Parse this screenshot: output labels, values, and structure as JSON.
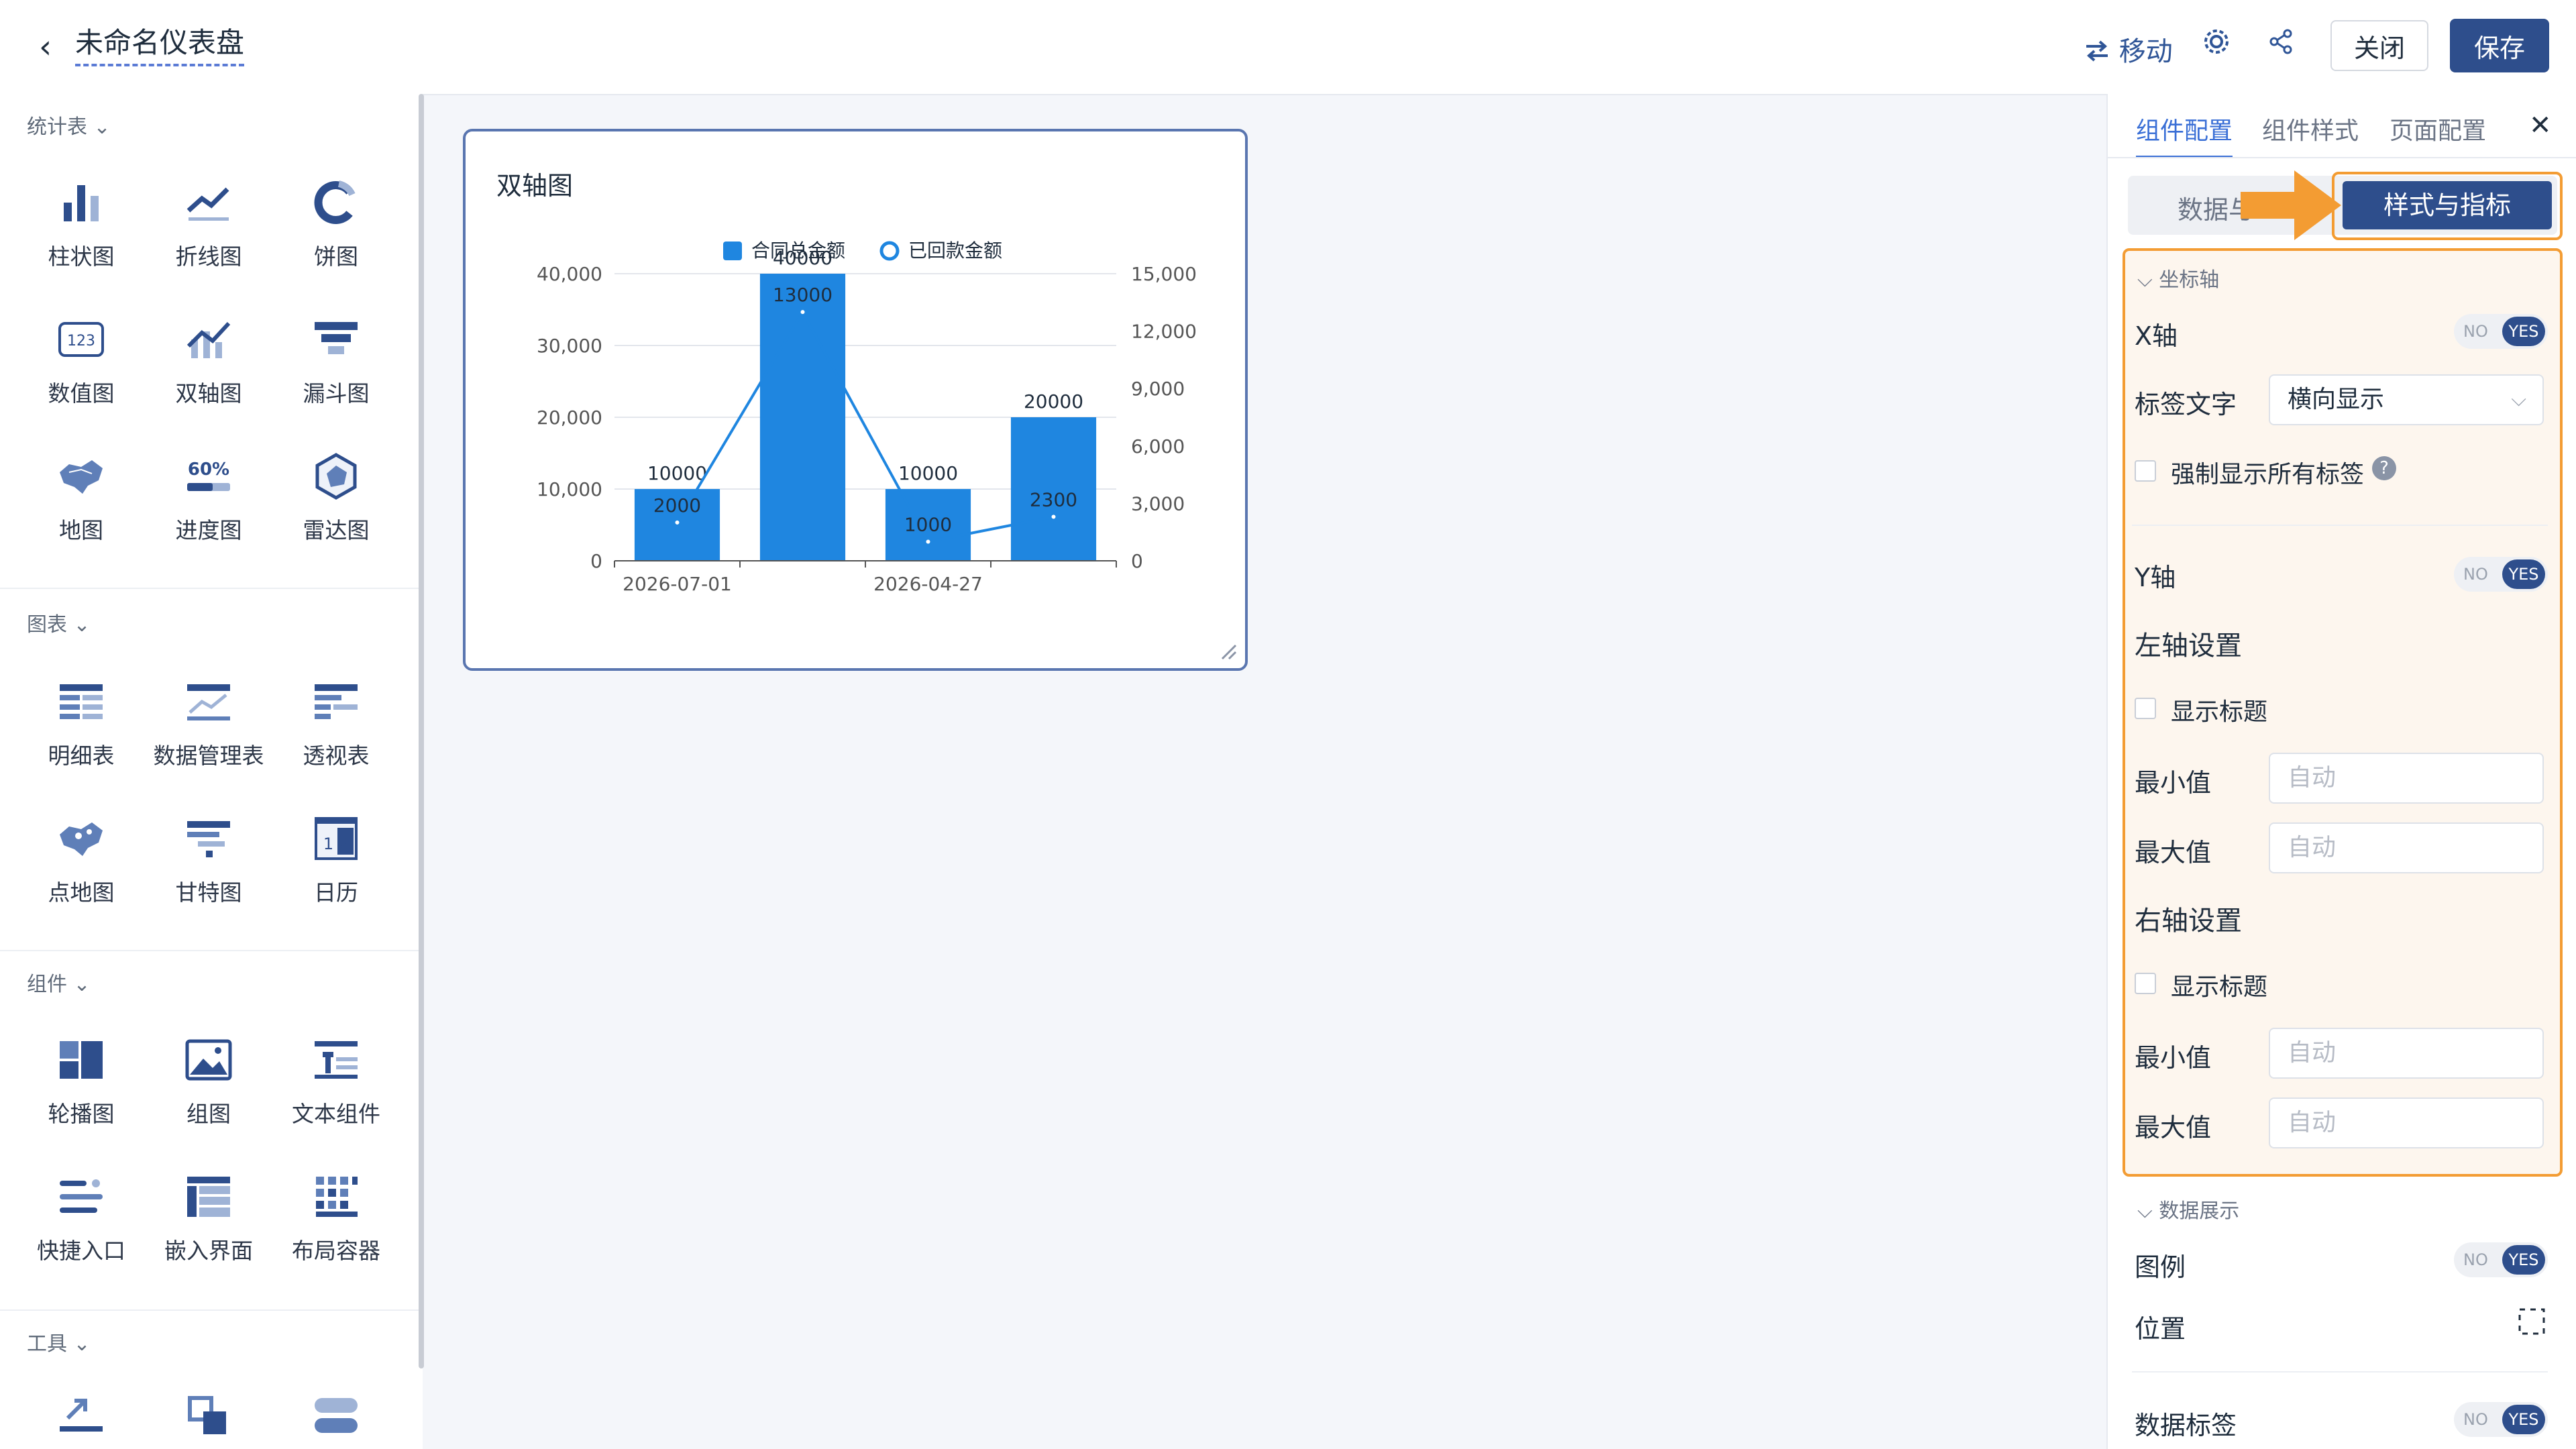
{
  "header": {
    "back_icon": "‹",
    "title": "未命名仪表盘",
    "move_label": "移动",
    "close_label": "关闭",
    "save_label": "保存"
  },
  "sidebar": {
    "section_stats": "统计表",
    "section_charts": "图表",
    "section_components": "组件",
    "section_tools": "工具",
    "stats_items": [
      "柱状图",
      "折线图",
      "饼图",
      "数值图",
      "双轴图",
      "漏斗图",
      "地图",
      "进度图",
      "雷达图"
    ],
    "chart_items": [
      "明细表",
      "数据管理表",
      "透视表",
      "点地图",
      "甘特图",
      "日历"
    ],
    "component_items": [
      "轮播图",
      "组图",
      "文本组件",
      "快捷入口",
      "嵌入界面",
      "布局容器"
    ],
    "icon_text": {
      "number": "123",
      "progress": "60%",
      "calendar": "1 2"
    }
  },
  "card": {
    "title": "双轴图"
  },
  "chart_data": {
    "type": "bar",
    "categories": [
      "2026-07-01",
      "",
      "2026-04-27",
      ""
    ],
    "xtick_labels": [
      "2026-07-01",
      "2026-04-27"
    ],
    "series": [
      {
        "name": "合同总金额",
        "type": "bar",
        "axis": "left",
        "values": [
          10000,
          40000,
          10000,
          20000
        ],
        "color": "#1f86e0"
      },
      {
        "name": "已回款金额",
        "type": "line",
        "axis": "right",
        "values": [
          2000,
          13000,
          1000,
          2300
        ],
        "color": "#1f86e0"
      }
    ],
    "left_axis": {
      "ticks": [
        "40,000",
        "30,000",
        "20,000",
        "10,000",
        "0"
      ],
      "ylim": [
        0,
        40000
      ]
    },
    "right_axis": {
      "ticks": [
        "15,000",
        "12,000",
        "9,000",
        "6,000",
        "3,000",
        "0"
      ],
      "ylim": [
        0,
        15000
      ]
    },
    "grid": true,
    "legend": "top-center"
  },
  "panel": {
    "tabs": [
      "组件配置",
      "组件样式",
      "页面配置"
    ],
    "close_icon": "✕",
    "subtab_data": "数据与",
    "subtab_style": "样式与指标",
    "axis_section": "坐标轴",
    "x_axis_label": "X轴",
    "label_text_label": "标签文字",
    "label_text_value": "横向显示",
    "force_show_label": "强制显示所有标签",
    "help_icon": "?",
    "y_axis_label": "Y轴",
    "left_axis_title": "左轴设置",
    "right_axis_title": "右轴设置",
    "show_title_label": "显示标题",
    "min_label": "最小值",
    "max_label": "最大值",
    "auto_placeholder": "自动",
    "data_display_section": "数据展示",
    "legend_label": "图例",
    "position_label": "位置",
    "data_label_label": "数据标签",
    "toggle_no": "NO",
    "toggle_yes": "YES"
  }
}
